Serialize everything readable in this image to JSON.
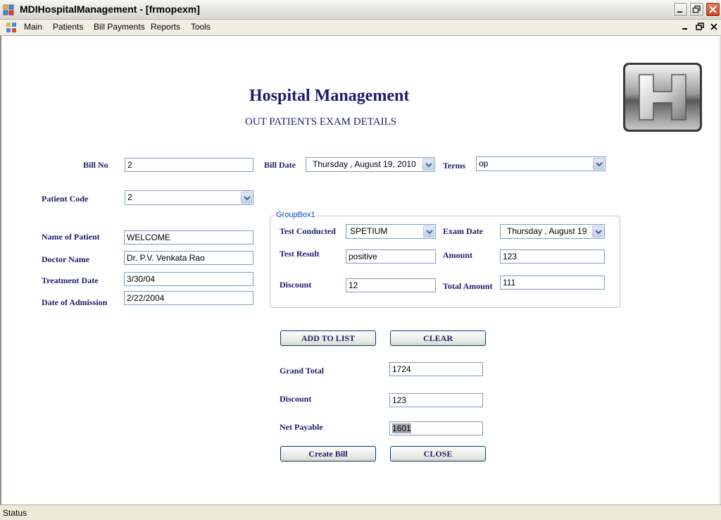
{
  "window": {
    "title": "MDIHospitalManagement - [frmopexm]"
  },
  "menu": {
    "items": [
      "Main",
      "Patients",
      "Bill Payments",
      "Reports",
      "Tools"
    ]
  },
  "header": {
    "title": "Hospital Management",
    "subtitle": "OUT PATIENTS EXAM DETAILS"
  },
  "bill": {
    "bill_no_label": "Bill No",
    "bill_no": "2",
    "bill_date_label": "Bill Date",
    "bill_date": "Thursday   ,    August    19, 2010",
    "terms_label": "Terms",
    "terms": "op"
  },
  "patient": {
    "code_label": "Patient Code",
    "code": "2",
    "name_label": "Name of Patient",
    "name": "WELCOME",
    "doctor_label": "Doctor Name",
    "doctor": "Dr. P.V. Venkata Rao",
    "treatment_label": "Treatment Date",
    "treatment": "3/30/04",
    "admission_label": "Date of Admission",
    "admission": "2/22/2004"
  },
  "group": {
    "title": "GroupBox1",
    "test_label": "Test Conducted",
    "test": "SPETIUM",
    "exam_date_label": "Exam Date",
    "exam_date": "Thursday  ,    August    19",
    "result_label": "Test Result",
    "result": "positive",
    "amount_label": "Amount",
    "amount": "123",
    "discount_label": "Discount",
    "discount": "12",
    "total_label": "Total Amount",
    "total": "111"
  },
  "actions": {
    "add": "ADD TO LIST",
    "clear": "CLEAR",
    "create": "Create Bill",
    "close": "CLOSE"
  },
  "totals": {
    "grand_label": "Grand Total",
    "grand": "1724",
    "discount_label": "Discount",
    "discount": "123",
    "net_label": "Net Payable",
    "net": "1601"
  },
  "status": {
    "text": "Status"
  },
  "icons": {
    "app": "app-icon",
    "logo": "hospital-logo-icon",
    "dropdown": "chevron-down-icon"
  },
  "colors": {
    "label": "#1c1c6e",
    "border": "#7f9db9",
    "group_title": "#0046d5"
  }
}
